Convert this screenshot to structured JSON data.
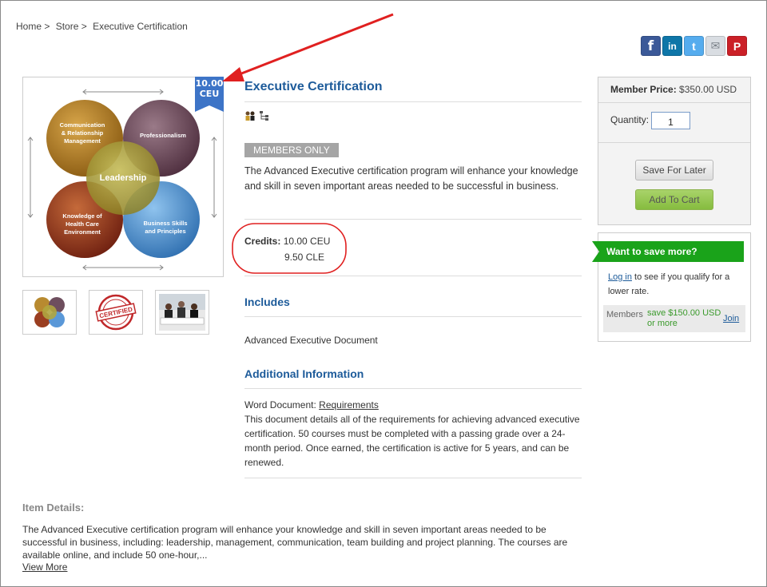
{
  "breadcrumb": {
    "home": "Home >",
    "store": "Store >",
    "current": "Executive Certification"
  },
  "social": {
    "facebook": "f",
    "linkedin": "in",
    "twitter": "t",
    "email": "✉",
    "pinterest": "P"
  },
  "badge": {
    "value": "10.00",
    "unit": "CEU"
  },
  "diagram": {
    "top_left": [
      "Communication",
      "& Relationship",
      "Management"
    ],
    "top_right": "Professionalism",
    "center": "Leadership",
    "bottom_left": [
      "Knowledge of",
      "Health Care",
      "Environment"
    ],
    "bottom_right": [
      "Business Skills",
      "and Principles"
    ]
  },
  "thumbnails": {
    "certified_stamp": "CERTIFIED"
  },
  "product": {
    "title": "Executive Certification",
    "members_only": "MEMBERS ONLY",
    "description": "The Advanced Executive certification program will enhance your knowledge and skill in seven important areas needed to be successful in business.",
    "credits_label": "Credits:",
    "credit_1": "10.00 CEU",
    "credit_2": "9.50 CLE"
  },
  "includes": {
    "heading": "Includes",
    "item": "Advanced Executive Document"
  },
  "additional": {
    "heading": "Additional Information",
    "doc_label": "Word Document:",
    "doc_link": "Requirements",
    "text": "This document details all of the requirements for achieving advanced executive certification. 50 courses must be completed with a passing grade over a 24-month period. Once earned, the certification is active for 5 years, and can be renewed."
  },
  "price_box": {
    "member_price_label": "Member Price:",
    "member_price_value": "$350.00 USD",
    "quantity_label": "Quantity:",
    "quantity_value": "1",
    "save_later": "Save For Later",
    "add_to_cart": "Add To Cart"
  },
  "save_more": {
    "banner": "Want to save more?",
    "login_link": "Log in",
    "login_text": "to see if you qualify for a lower rate.",
    "members_label": "Members",
    "members_save": "save $150.00 USD or more",
    "join": "Join"
  },
  "item_details": {
    "heading": "Item Details:",
    "text": "The Advanced Executive certification program will enhance your knowledge and skill in seven important areas needed to be successful in business, including: leadership, management, communication, team building and project planning. The courses are available online, and include 50 one-hour,...",
    "view_more": "View More"
  },
  "colors": {
    "link_blue": "#1d5b9a",
    "annotation_red": "#e02020",
    "banner_green": "#1aa31a"
  }
}
